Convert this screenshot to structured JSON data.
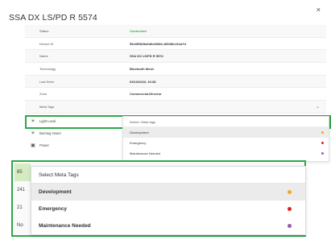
{
  "panel": {
    "title": "SSA DX LS/PD R 5574",
    "close_glyph": "×"
  },
  "details": [
    {
      "label": "Status",
      "value": "Connected"
    },
    {
      "label": "Device ID",
      "value": "55c9f5829a6d6e836fa.1894f6e411a7d"
    },
    {
      "label": "Name",
      "value": "SSA DX LS/PD R 5574"
    },
    {
      "label": "Technology",
      "value": "Bluetooth Mesh"
    },
    {
      "label": "Last Seen",
      "value": "03/10/2023, 16:38"
    },
    {
      "label": "Zone",
      "value": "Commercial-Director"
    },
    {
      "label": "Meta Tags",
      "value": ""
    }
  ],
  "sensor_rows": [
    {
      "icon": "sun-icon",
      "label": "Light Level",
      "pct": "85"
    },
    {
      "icon": "sun-icon",
      "label": "Burning Hours",
      "pct": "241"
    },
    {
      "icon": "power-icon",
      "label": "Power",
      "pct": "21"
    }
  ],
  "meta_tags_dropdown": {
    "placeholder": "Select Meta Tags",
    "small_placeholder": "Select / Meta tags",
    "options": [
      {
        "label": "Development",
        "color": "#f5a623"
      },
      {
        "label": "Emergency",
        "color": "#e02020"
      },
      {
        "label": "Maintenance Needed",
        "color": "#9b59b6"
      }
    ]
  },
  "zoom_left_values": [
    "85",
    "241",
    "21",
    "No"
  ]
}
